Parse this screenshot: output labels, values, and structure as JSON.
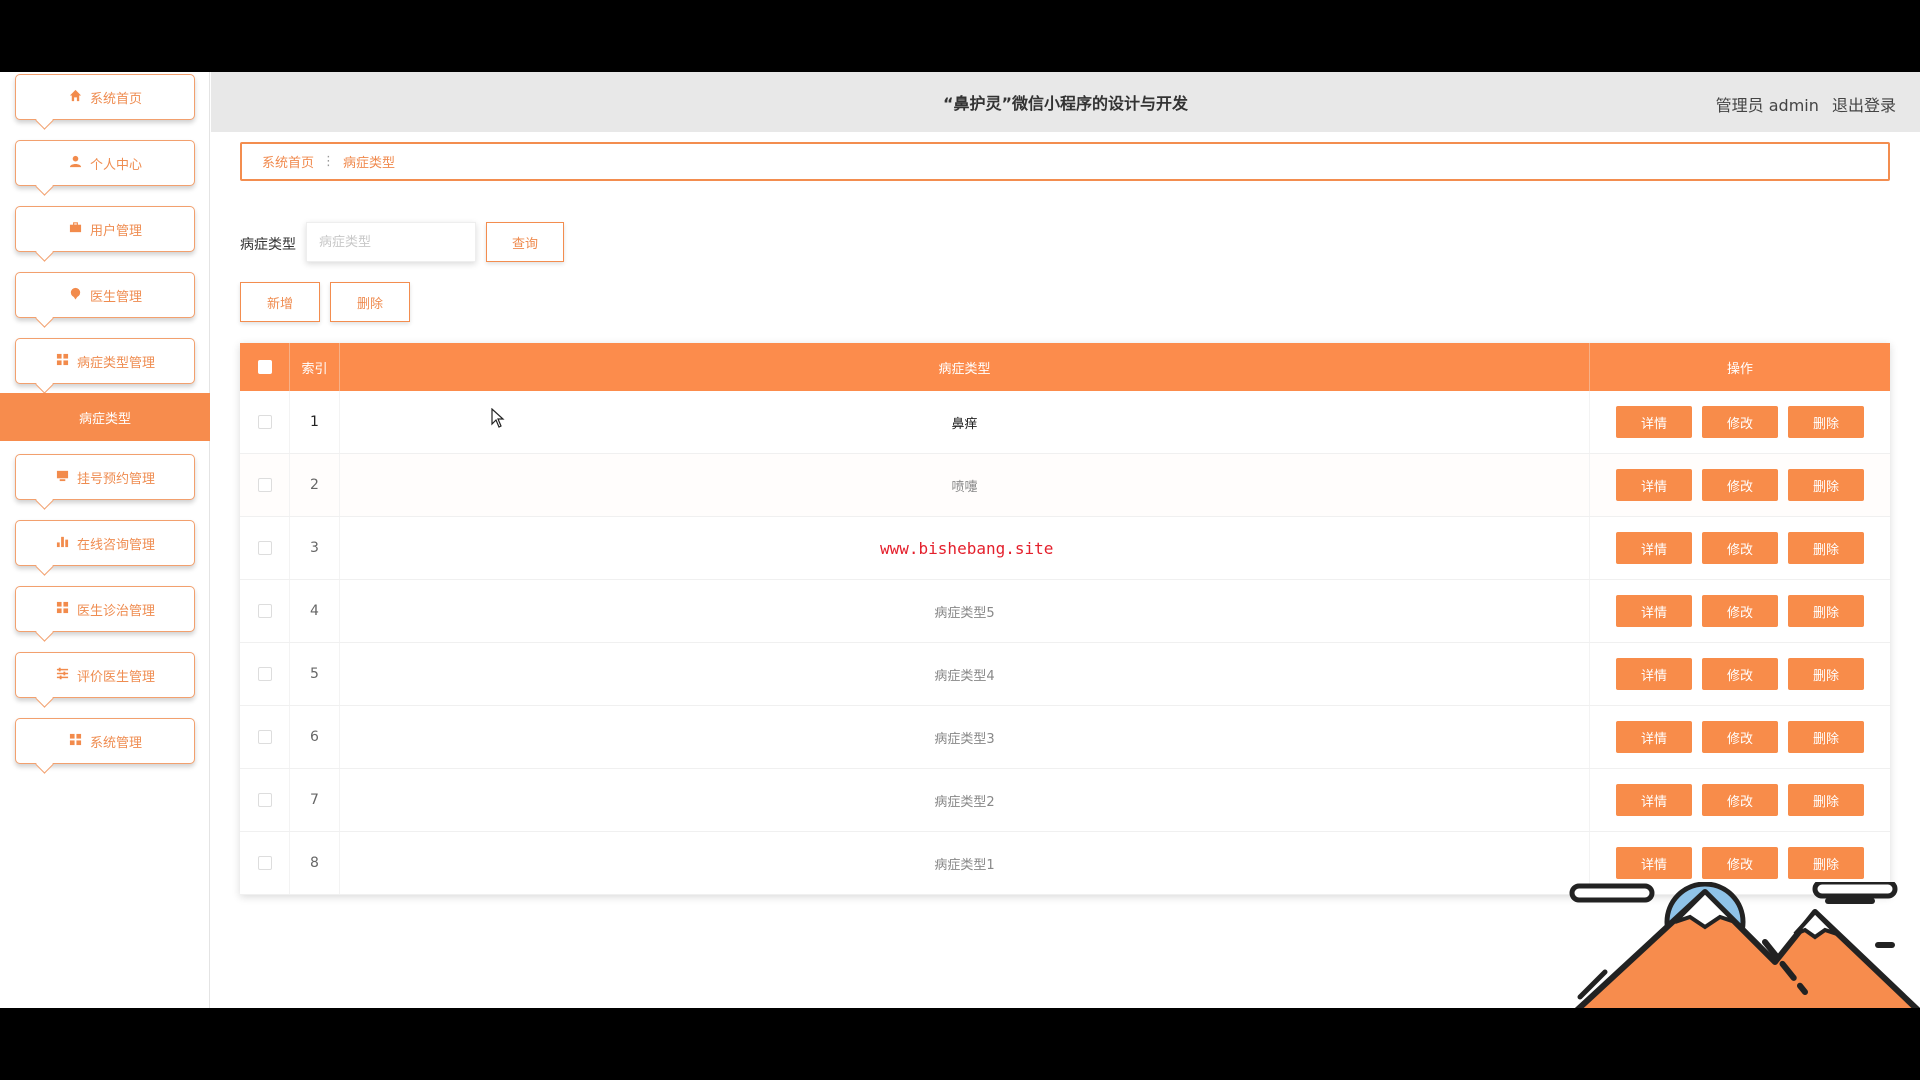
{
  "sidebar": {
    "items": [
      {
        "label": "系统首页",
        "icon": "home-icon"
      },
      {
        "label": "个人中心",
        "icon": "user-icon"
      },
      {
        "label": "用户管理",
        "icon": "briefcase-icon"
      },
      {
        "label": "医生管理",
        "icon": "pin-icon"
      },
      {
        "label": "病症类型管理",
        "icon": "grid-icon"
      },
      {
        "label": "挂号预约管理",
        "icon": "monitor-icon"
      },
      {
        "label": "在线咨询管理",
        "icon": "bar-chart-icon"
      },
      {
        "label": "医生诊治管理",
        "icon": "grid-icon"
      },
      {
        "label": "评价医生管理",
        "icon": "sliders-icon"
      },
      {
        "label": "系统管理",
        "icon": "grid-icon"
      }
    ],
    "active_sub": "病症类型"
  },
  "header": {
    "title": "“鼻护灵”微信小程序的设计与开发",
    "role": "管理员 admin",
    "logout": "退出登录"
  },
  "breadcrumb": {
    "home": "系统首页",
    "current": "病症类型"
  },
  "search": {
    "label": "病症类型",
    "placeholder": "病症类型",
    "button": "查询"
  },
  "actions": {
    "add": "新增",
    "delete": "删除"
  },
  "table": {
    "headers": {
      "index": "索引",
      "name": "病症类型",
      "ops": "操作"
    },
    "op_labels": {
      "detail": "详情",
      "edit": "修改",
      "delete": "删除"
    },
    "rows": [
      {
        "index": "1",
        "name": "鼻痒"
      },
      {
        "index": "2",
        "name": "喷嚏"
      },
      {
        "index": "3",
        "name": ""
      },
      {
        "index": "4",
        "name": "病症类型5"
      },
      {
        "index": "5",
        "name": "病症类型4"
      },
      {
        "index": "6",
        "name": "病症类型3"
      },
      {
        "index": "7",
        "name": "病症类型2"
      },
      {
        "index": "8",
        "name": "病症类型1"
      }
    ]
  },
  "watermark": "www.bishebang.site",
  "colors": {
    "accent": "#fc8c4c",
    "header_bg": "#e8e8e8",
    "watermark": "#e4202c"
  }
}
